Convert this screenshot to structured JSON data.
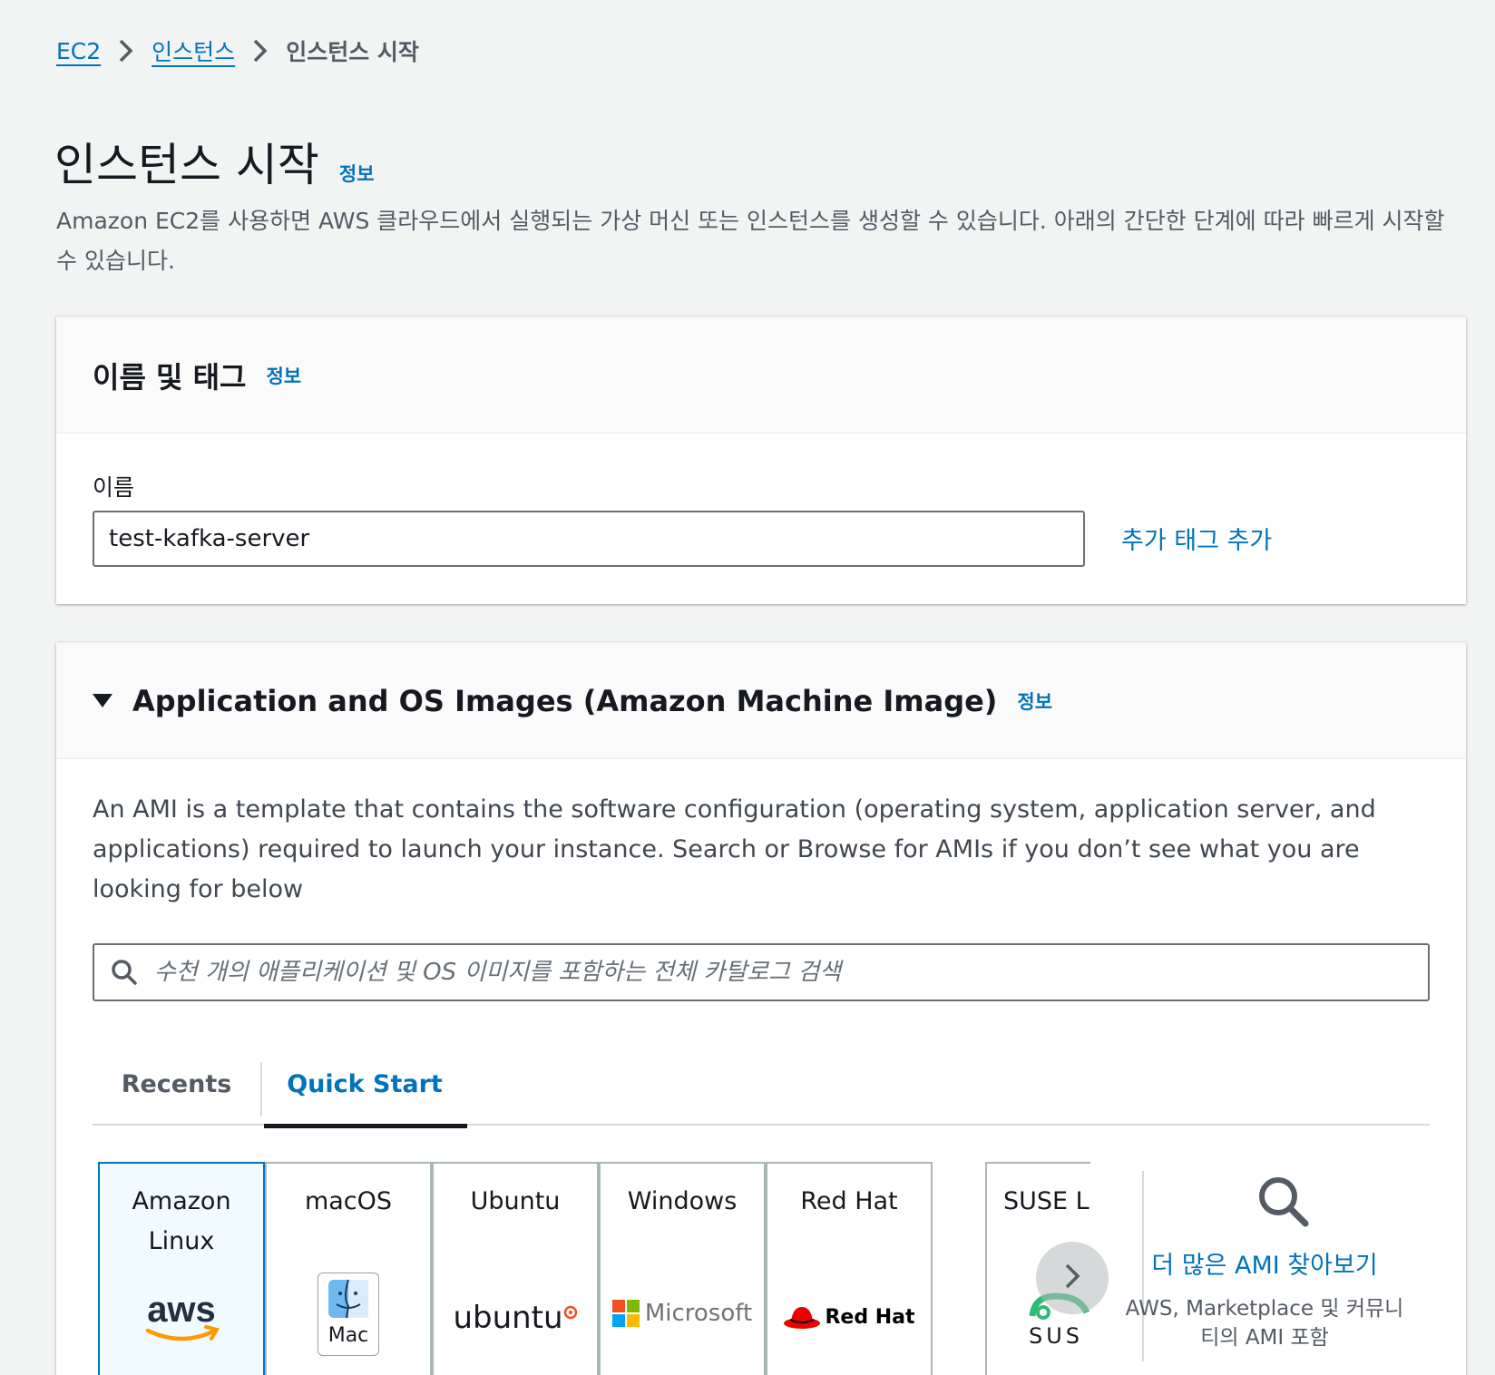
{
  "breadcrumb": {
    "items": [
      "EC2",
      "인스턴스",
      "인스턴스 시작"
    ]
  },
  "page": {
    "title": "인스턴스 시작",
    "info": "정보",
    "description": "Amazon EC2를 사용하면 AWS 클라우드에서 실행되는 가상 머신 또는 인스턴스를 생성할 수 있습니다. 아래의 간단한 단계에 따라 빠르게 시작할 수 있습니다."
  },
  "name_tags": {
    "title": "이름 및 태그",
    "info": "정보",
    "name_label": "이름",
    "name_value": "test-kafka-server",
    "add_tag_label": "추가 태그 추가"
  },
  "ami": {
    "title": "Application and OS Images (Amazon Machine Image)",
    "info": "정보",
    "description": "An AMI is a template that contains the software configuration (operating system, application server, and applications) required to launch your instance. Search or Browse for AMIs if you don’t see what you are looking for below",
    "search_placeholder": "수천 개의 애플리케이션 및 OS 이미지를 포함하는 전체 카탈로그 검색",
    "tabs": [
      "Recents",
      "Quick Start"
    ],
    "active_tab": "Quick Start",
    "os_cards": [
      {
        "name": "Amazon Linux",
        "logo_text": "aws",
        "selected": true
      },
      {
        "name": "macOS",
        "logo_text": "Mac",
        "selected": false
      },
      {
        "name": "Ubuntu",
        "logo_text": "ubuntu",
        "selected": false
      },
      {
        "name": "Windows",
        "logo_text": "Microsoft",
        "selected": false
      },
      {
        "name": "Red Hat",
        "logo_text": "Red Hat",
        "selected": false
      },
      {
        "name": "SUSE Li",
        "logo_text": "SUS",
        "selected": false
      }
    ],
    "browse_link": "더 많은 AMI 찾아보기",
    "browse_sub": "AWS, Marketplace 및 커뮤니티의 AMI 포함"
  },
  "colors": {
    "link": "#0073bb",
    "background": "#f2f3f3",
    "selected_card": "#f1faff",
    "redhat": "#ee0000",
    "aws_smile": "#ff9900"
  }
}
